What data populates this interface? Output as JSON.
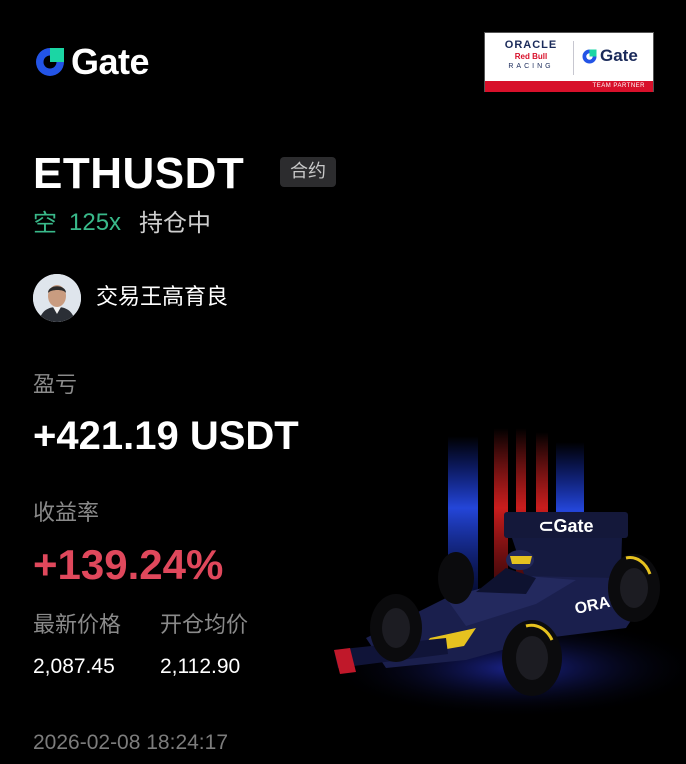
{
  "brand": {
    "name": "Gate",
    "accent": "#2354e6"
  },
  "partner": {
    "oracle": "ORACLE",
    "red_bull": "Red Bull",
    "racing": "RACING",
    "gate": "Gate",
    "team_partner": "TEAM PARTNER"
  },
  "position": {
    "symbol": "ETHUSDT",
    "tag": "合约",
    "side": "空",
    "leverage": "125x",
    "status": "持仓中"
  },
  "trader": {
    "name": "交易王高育良"
  },
  "pnl": {
    "label": "盈亏",
    "value": "+421.19 USDT"
  },
  "roi": {
    "label": "收益率",
    "value": "+139.24%"
  },
  "prices": {
    "last_label": "最新价格",
    "last_value": "2,087.45",
    "entry_label": "开仓均价",
    "entry_value": "2,112.90"
  },
  "timestamp": "2026-02-08 18:24:17",
  "colors": {
    "profit": "#e0485c",
    "short": "#39b98a",
    "muted": "#8a8a8a"
  }
}
